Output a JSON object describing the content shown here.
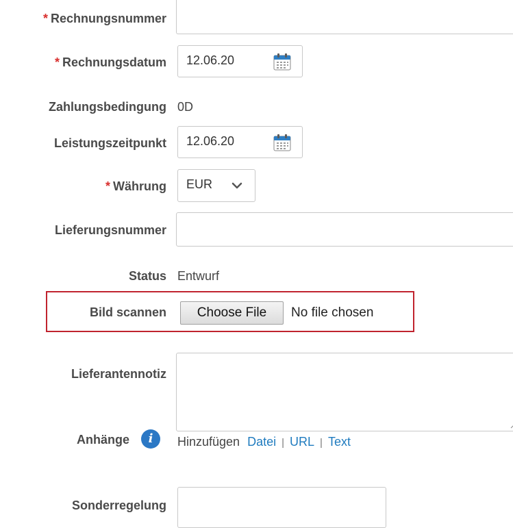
{
  "form": {
    "invoice_number": {
      "label": "Rechnungsnummer",
      "required_marker": "*",
      "value": ""
    },
    "invoice_date": {
      "label": "Rechnungsdatum",
      "required_marker": "*",
      "value": "12.06.20",
      "icon": "calendar-icon"
    },
    "payment_terms": {
      "label": "Zahlungsbedingung",
      "value": "0D"
    },
    "service_date": {
      "label": "Leistungszeitpunkt",
      "value": "12.06.20",
      "icon": "calendar-icon"
    },
    "currency": {
      "label": "Währung",
      "required_marker": "*",
      "value": "EUR",
      "icon": "chevron-down-icon"
    },
    "delivery_number": {
      "label": "Lieferungsnummer",
      "value": ""
    },
    "status": {
      "label": "Status",
      "value": "Entwurf"
    },
    "scan_image": {
      "label": "Bild scannen",
      "button_label": "Choose File",
      "file_status": "No file chosen",
      "highlight_color": "#c0232e"
    },
    "supplier_note": {
      "label": "Lieferantennotiz",
      "value": ""
    },
    "attachments": {
      "label": "Anhänge",
      "info_icon_glyph": "i",
      "add_label": "Hinzufügen",
      "links": [
        "Datei",
        "URL",
        "Text"
      ],
      "separator": "|"
    },
    "special_rule": {
      "label": "Sonderregelung",
      "value": ""
    }
  },
  "colors": {
    "required": "#d9302f",
    "link": "#1f7bbf",
    "calendar_icon": "#2f7fc4",
    "info_icon": "#2b78c5"
  }
}
